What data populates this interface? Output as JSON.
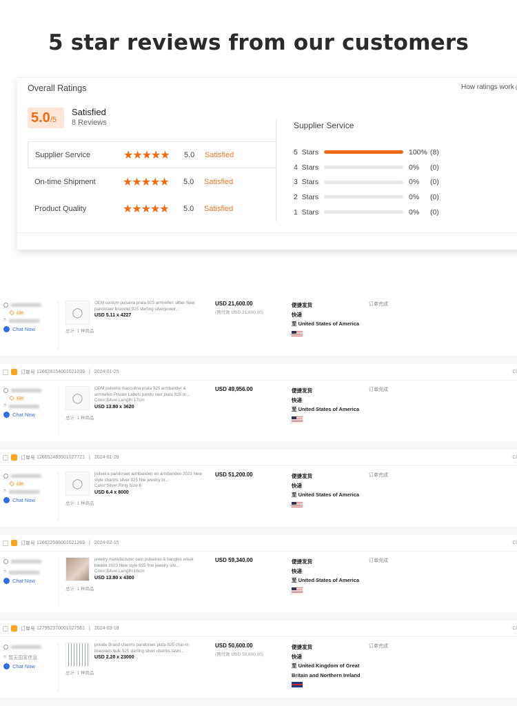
{
  "headline": "5 star reviews from our customers",
  "ratings": {
    "overall_label": "Overall Ratings",
    "how_link": "How ratings work",
    "help_icon": "?",
    "score": "5.0",
    "score_max": "/5",
    "score_label": "Satisfied",
    "reviews": "8 Reviews",
    "categories": [
      {
        "label": "Supplier Service",
        "stars": 5,
        "value": "5.0",
        "status": "Satisfied"
      },
      {
        "label": "On-time Shipment",
        "stars": 5,
        "value": "5.0",
        "status": "Satisfied"
      },
      {
        "label": "Product Quality",
        "stars": 5,
        "value": "5.0",
        "status": "Satisfied"
      }
    ],
    "breakdown_title": "Supplier Service",
    "breakdown": [
      {
        "label": "5  Stars",
        "percent": 100,
        "pct_text": "100%",
        "count": "(8)"
      },
      {
        "label": "4  Stars",
        "percent": 0,
        "pct_text": "0%",
        "count": "(0)"
      },
      {
        "label": "3  Stars",
        "percent": 0,
        "pct_text": "0%",
        "count": "(0)"
      },
      {
        "label": "2  Stars",
        "percent": 0,
        "pct_text": "0%",
        "count": "(0)"
      },
      {
        "label": "1  Stars",
        "percent": 0,
        "pct_text": "0%",
        "count": "(0)"
      }
    ]
  },
  "colors": {
    "accent": "#f26a10",
    "link": "#2f6fe4"
  },
  "orders": [
    {
      "order_no": null,
      "date": null,
      "level": "L1+",
      "country_text": null,
      "chat": "Chat Now",
      "title": "OEM custom pulseira prata 925 armreifen silber New pandoraer bracelet 925 sterling silverjewelr...",
      "option": null,
      "qty": "USD 5.11 x 4227",
      "total": "总计: 1 种商品",
      "price": "USD 21,600.00",
      "prepay": "(预付款 USD 21,600.00)",
      "ship1": "便捷发货",
      "ship2": "快递",
      "dest": "至 United States of America",
      "flag": "us",
      "status": "订单完成",
      "thumb": "bracelets"
    },
    {
      "order_prefix": "订单号",
      "order_no": "126628154001021039",
      "date": "2024-01-25",
      "level": "L1+",
      "country_text": null,
      "chat": "Chat Now",
      "title": "ODM pulseira masculina prata 925 armbander & armreifen Private Labels pando raer plata 925 or...",
      "option": "Color:Silver,Length:17cm",
      "qty": "USD 13.80 x 3620",
      "total": "总计: 1 种商品",
      "price": "USD 49,956.00",
      "prepay": null,
      "ship1": "便捷发货",
      "ship2": "快递",
      "dest": "至 United States of America",
      "flag": "us",
      "status": "订单完成",
      "thumb": "bracelet",
      "right_cut": "Cl"
    },
    {
      "order_prefix": "订单号",
      "order_no": "126652483501027721",
      "date": "2024-01-29",
      "level": "L1+",
      "country_text": null,
      "chat": "Chat Now",
      "title": "pulseira pandoraer armbanden en armbanden 2023 New style charms silver 925 fine jewelry br...",
      "option": "Color:Silver,Ring Size:6",
      "qty": "USD 6.4 x 8000",
      "total": "总计: 1 种商品",
      "price": "USD 51,200.00",
      "prepay": null,
      "ship1": "便捷发货",
      "ship2": "快递",
      "dest": "至 United States of America",
      "flag": "us",
      "status": "订单完成",
      "thumb": "bracelet",
      "right_cut": "Cl"
    },
    {
      "order_prefix": "订单号",
      "order_no": "126622586001021269",
      "date": "2024-02-15",
      "level": null,
      "country_text": null,
      "chat": "Chat Now",
      "title": "jewelry manufacturer oem pulseiras & bangles erkek bileklik 2023 New style 925 fine jewelry silv...",
      "option": "Color:Silver,Length:16cm",
      "qty": "USD 13.80 x 4300",
      "total": "总计: 1 种商品",
      "price": "USD 59,340.00",
      "prepay": null,
      "ship1": "便捷发货",
      "ship2": "快递",
      "dest": "至 United States of America",
      "flag": "us",
      "status": "订单完成",
      "thumb": "photo",
      "right_cut": "Cl"
    },
    {
      "order_prefix": "订单号",
      "order_no": "127952370001027561",
      "date": "2024-03-18",
      "level": null,
      "country_text": "暂无国家信息",
      "chat": "Chat Now",
      "title": "private Brand charms pandoraer plata 925 char-m bracelets bulk 925 sterling silver charms fashi...",
      "option": null,
      "qty": "USD 2.20 x 23000",
      "total": "总计: 1 种商品",
      "price": "USD 50,600.00",
      "prepay": "(预付款 USD 50,600.00)",
      "ship1": "便捷发货",
      "ship2": "快递",
      "dest": "至 United Kingdom of Great Britain and Northern Ireland",
      "flag": "uk",
      "status": "订单完成",
      "thumb": "grid",
      "right_cut": "Cl"
    }
  ]
}
